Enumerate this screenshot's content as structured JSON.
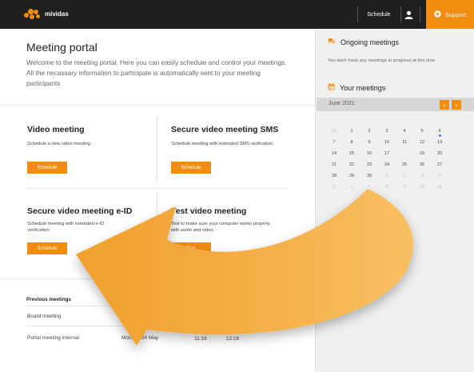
{
  "app": {
    "logo_text": "mividas"
  },
  "nav": {
    "schedule_label": "Schedule",
    "support_label": "Support"
  },
  "portal": {
    "title": "Meeting portal",
    "intro": "Welcome to the meeting portal. Here you can easily schedule and control your meetings. All the necassary information to participate is automatically sent to your meeting participants"
  },
  "cards": [
    {
      "title": "Video meeting",
      "description": "Schedule a new video meeting",
      "button_label": "Schedule"
    },
    {
      "title": "Secure video meeting SMS",
      "description": "Schedule meeting with extended SMS verification",
      "button_label": "Schedule"
    },
    {
      "title": "Secure video meeting e-ID",
      "description": "Schedule meeting with extended e-ID verification",
      "button_label": "Schedule"
    },
    {
      "title": "Test video meeting",
      "description": "Test to make sure your computer works properly with audio and video.",
      "button_label": "Test"
    }
  ],
  "previous": {
    "heading": "Previous meetings",
    "rows": [
      {
        "name": "Board meeting",
        "date": "Sunday 3 May",
        "start": "20:13",
        "end": ""
      },
      {
        "name": "Portal meeting internal",
        "date": "Monday 24 May",
        "start": "11:16",
        "end": "12:16"
      }
    ],
    "remove_label": "×"
  },
  "sidebar": {
    "ongoing_heading": "Ongoing meetings",
    "ongoing_note": "You don't have any meetings in progress at this time",
    "your_meetings_heading": "Your meetings",
    "month_label": "June 2021",
    "prev_label": "‹",
    "next_label": "›",
    "calendar_weeks": [
      [
        "31",
        "1",
        "2",
        "3",
        "4",
        "5",
        "6"
      ],
      [
        "7",
        "8",
        "9",
        "10",
        "11",
        "12",
        "13"
      ],
      [
        "14",
        "15",
        "16",
        "17",
        "18",
        "19",
        "20"
      ],
      [
        "21",
        "22",
        "23",
        "24",
        "25",
        "26",
        "27"
      ],
      [
        "28",
        "29",
        "30",
        "1",
        "2",
        "3",
        "4"
      ],
      [
        "5",
        "6",
        "7",
        "8",
        "9",
        "10",
        "11"
      ]
    ],
    "today": "18",
    "event_day": "6"
  },
  "colors": {
    "accent": "#f28c0f",
    "topbar": "#1f1f1f",
    "sidebar": "#f0f0f0",
    "event_dot": "#2d7ce0",
    "danger": "#e33333"
  },
  "icons": [
    "logo-icon",
    "user-icon",
    "support-icon",
    "chat-icon",
    "calendar-icon",
    "close-icon"
  ]
}
